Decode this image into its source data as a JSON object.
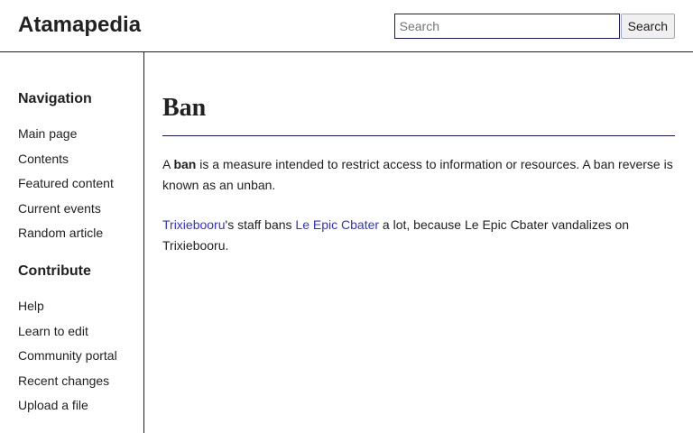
{
  "header": {
    "site_title": "Atamapedia",
    "search": {
      "placeholder": "Search",
      "value": "",
      "button_label": "Search"
    }
  },
  "sidebar": {
    "navigation": {
      "heading": "Navigation",
      "items": [
        {
          "label": "Main page"
        },
        {
          "label": "Contents"
        },
        {
          "label": "Featured content"
        },
        {
          "label": "Current events"
        },
        {
          "label": "Random article"
        }
      ]
    },
    "contribute": {
      "heading": "Contribute",
      "items": [
        {
          "label": "Help"
        },
        {
          "label": "Learn to edit"
        },
        {
          "label": "Community portal"
        },
        {
          "label": "Recent changes"
        },
        {
          "label": "Upload a file"
        }
      ]
    }
  },
  "article": {
    "title": "Ban",
    "para1": {
      "prefix": "A ",
      "bold": "ban",
      "suffix": " is a measure intended to restrict access to information or resources. A ban reverse is known as an unban."
    },
    "para2": {
      "link1": "Trixiebooru",
      "text1": "'s staff bans ",
      "link2": "Le Epic Cbater",
      "text2": " a lot, because Le Epic Cbater vandalizes on Trixiebooru."
    }
  },
  "colors": {
    "link": "#3333cc",
    "rule": "#1a1a5a",
    "text": "#202122"
  }
}
